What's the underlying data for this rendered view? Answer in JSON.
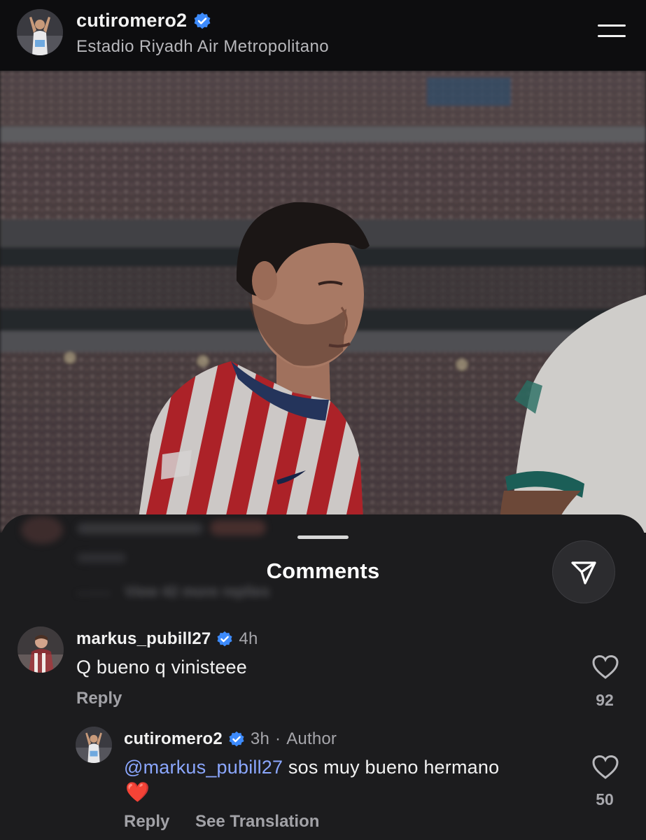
{
  "header": {
    "username": "cutiromero2",
    "location": "Estadio Riyadh Air Metropolitano",
    "verified_icon": "verified-badge-icon",
    "menu_icon": "menu-icon"
  },
  "sheet": {
    "title": "Comments",
    "share_icon": "send-icon",
    "obscured_text": "View 42 more replies"
  },
  "comments": [
    {
      "username": "markus_pubill27",
      "time": "4h",
      "text": "Q bueno q vinisteee",
      "reply_label": "Reply",
      "likes": "92"
    }
  ],
  "reply": {
    "username": "cutiromero2",
    "time": "3h",
    "separator": "·",
    "badge": "Author",
    "mention": "@markus_pubill27",
    "text": " sos muy bueno hermano",
    "emoji": "❤️",
    "reply_label": "Reply",
    "translate_label": "See Translation",
    "likes": "50"
  },
  "colors": {
    "accent_mention": "#8ba7ff",
    "verified_blue": "#3d8bfd",
    "jersey_red": "#c4272e"
  }
}
